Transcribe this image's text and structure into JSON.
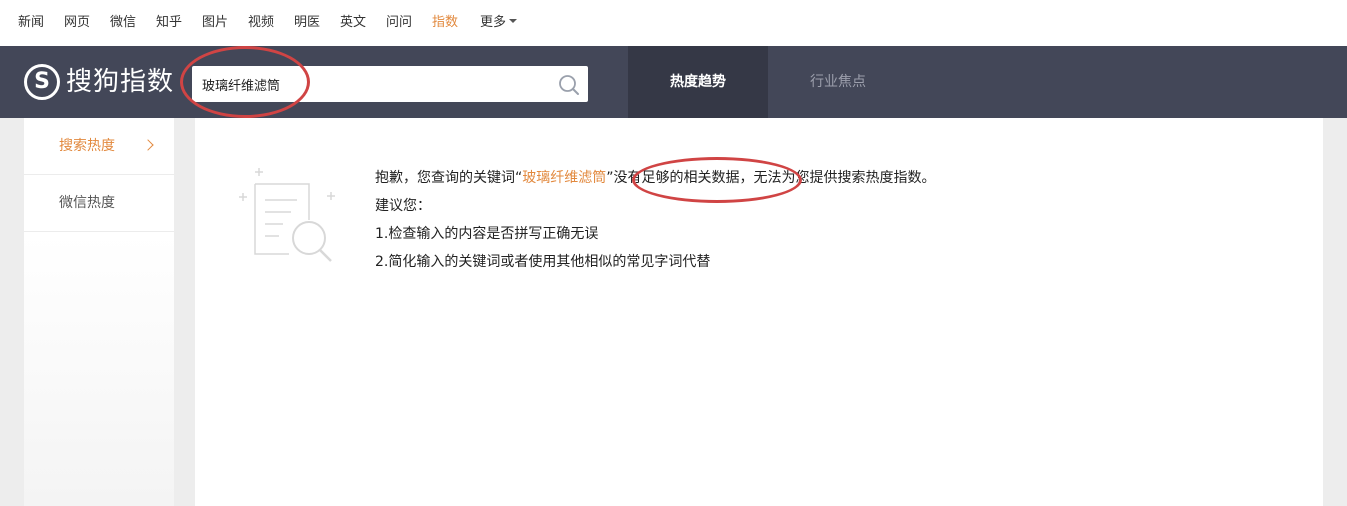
{
  "topnav": {
    "items": [
      {
        "label": "新闻"
      },
      {
        "label": "网页"
      },
      {
        "label": "微信"
      },
      {
        "label": "知乎"
      },
      {
        "label": "图片"
      },
      {
        "label": "视频"
      },
      {
        "label": "明医"
      },
      {
        "label": "英文"
      },
      {
        "label": "问问"
      },
      {
        "label": "指数",
        "active": true
      },
      {
        "label": "更多"
      }
    ]
  },
  "header": {
    "logo_text": "搜狗指数",
    "logo_letter": "S",
    "search_value": "玻璃纤维滤筒",
    "tabs": [
      {
        "label": "热度趋势",
        "active": true
      },
      {
        "label": "行业焦点",
        "active": false
      }
    ]
  },
  "sidebar": {
    "items": [
      {
        "label": "搜索热度",
        "active": true
      },
      {
        "label": "微信热度",
        "active": false
      }
    ]
  },
  "message": {
    "prefix": "抱歉，您查询的关键词“",
    "keyword": "玻璃纤维滤筒",
    "suffix": "”没有足够的相关数据，无法为您提供搜索热度指数。",
    "advice_title": "建议您：",
    "tips": [
      "1.检查输入的内容是否拼写正确无误",
      "2.简化输入的关键词或者使用其他相似的常见字词代替"
    ]
  },
  "colors": {
    "accent": "#e2893e",
    "header_bg": "#434758",
    "active_tab_bg": "#353846",
    "annotation": "#d04444"
  }
}
